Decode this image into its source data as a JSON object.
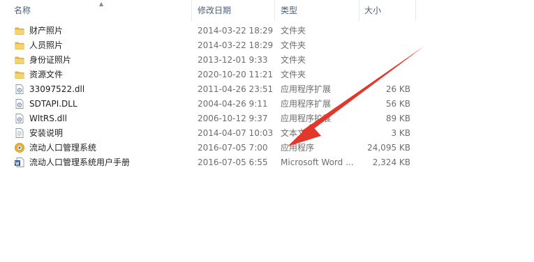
{
  "columns": {
    "name": "名称",
    "date": "修改日期",
    "type": "类型",
    "size": "大小"
  },
  "colors": {
    "header_text": "#4c607a",
    "folder": "#e9b949",
    "arrow": "#e2372b"
  },
  "files": [
    {
      "name": "财产照片",
      "date": "2014-03-22 18:29",
      "type": "文件夹",
      "size": "",
      "icon": "folder-icon"
    },
    {
      "name": "人员照片",
      "date": "2014-03-22 18:29",
      "type": "文件夹",
      "size": "",
      "icon": "folder-icon"
    },
    {
      "name": "身份证照片",
      "date": "2013-12-01 9:33",
      "type": "文件夹",
      "size": "",
      "icon": "folder-icon"
    },
    {
      "name": "资源文件",
      "date": "2020-10-20 11:21",
      "type": "文件夹",
      "size": "",
      "icon": "folder-icon"
    },
    {
      "name": "33097522.dll",
      "date": "2011-04-26 23:51",
      "type": "应用程序扩展",
      "size": "26 KB",
      "icon": "dll-file-icon"
    },
    {
      "name": "SDTAPI.DLL",
      "date": "2004-04-26 9:11",
      "type": "应用程序扩展",
      "size": "56 KB",
      "icon": "dll-file-icon"
    },
    {
      "name": "WltRS.dll",
      "date": "2006-10-12 9:37",
      "type": "应用程序扩展",
      "size": "89 KB",
      "icon": "dll-file-icon"
    },
    {
      "name": "安装说明",
      "date": "2014-04-07 10:03",
      "type": "文本文档",
      "size": "3 KB",
      "icon": "text-file-icon"
    },
    {
      "name": "流动人口管理系统",
      "date": "2016-07-05 7:00",
      "type": "应用程序",
      "size": "24,095 KB",
      "icon": "application-icon"
    },
    {
      "name": "流动人口管理系统用户手册",
      "date": "2016-07-05 6:55",
      "type": "Microsoft Word ...",
      "size": "2,324 KB",
      "icon": "word-document-icon"
    }
  ]
}
